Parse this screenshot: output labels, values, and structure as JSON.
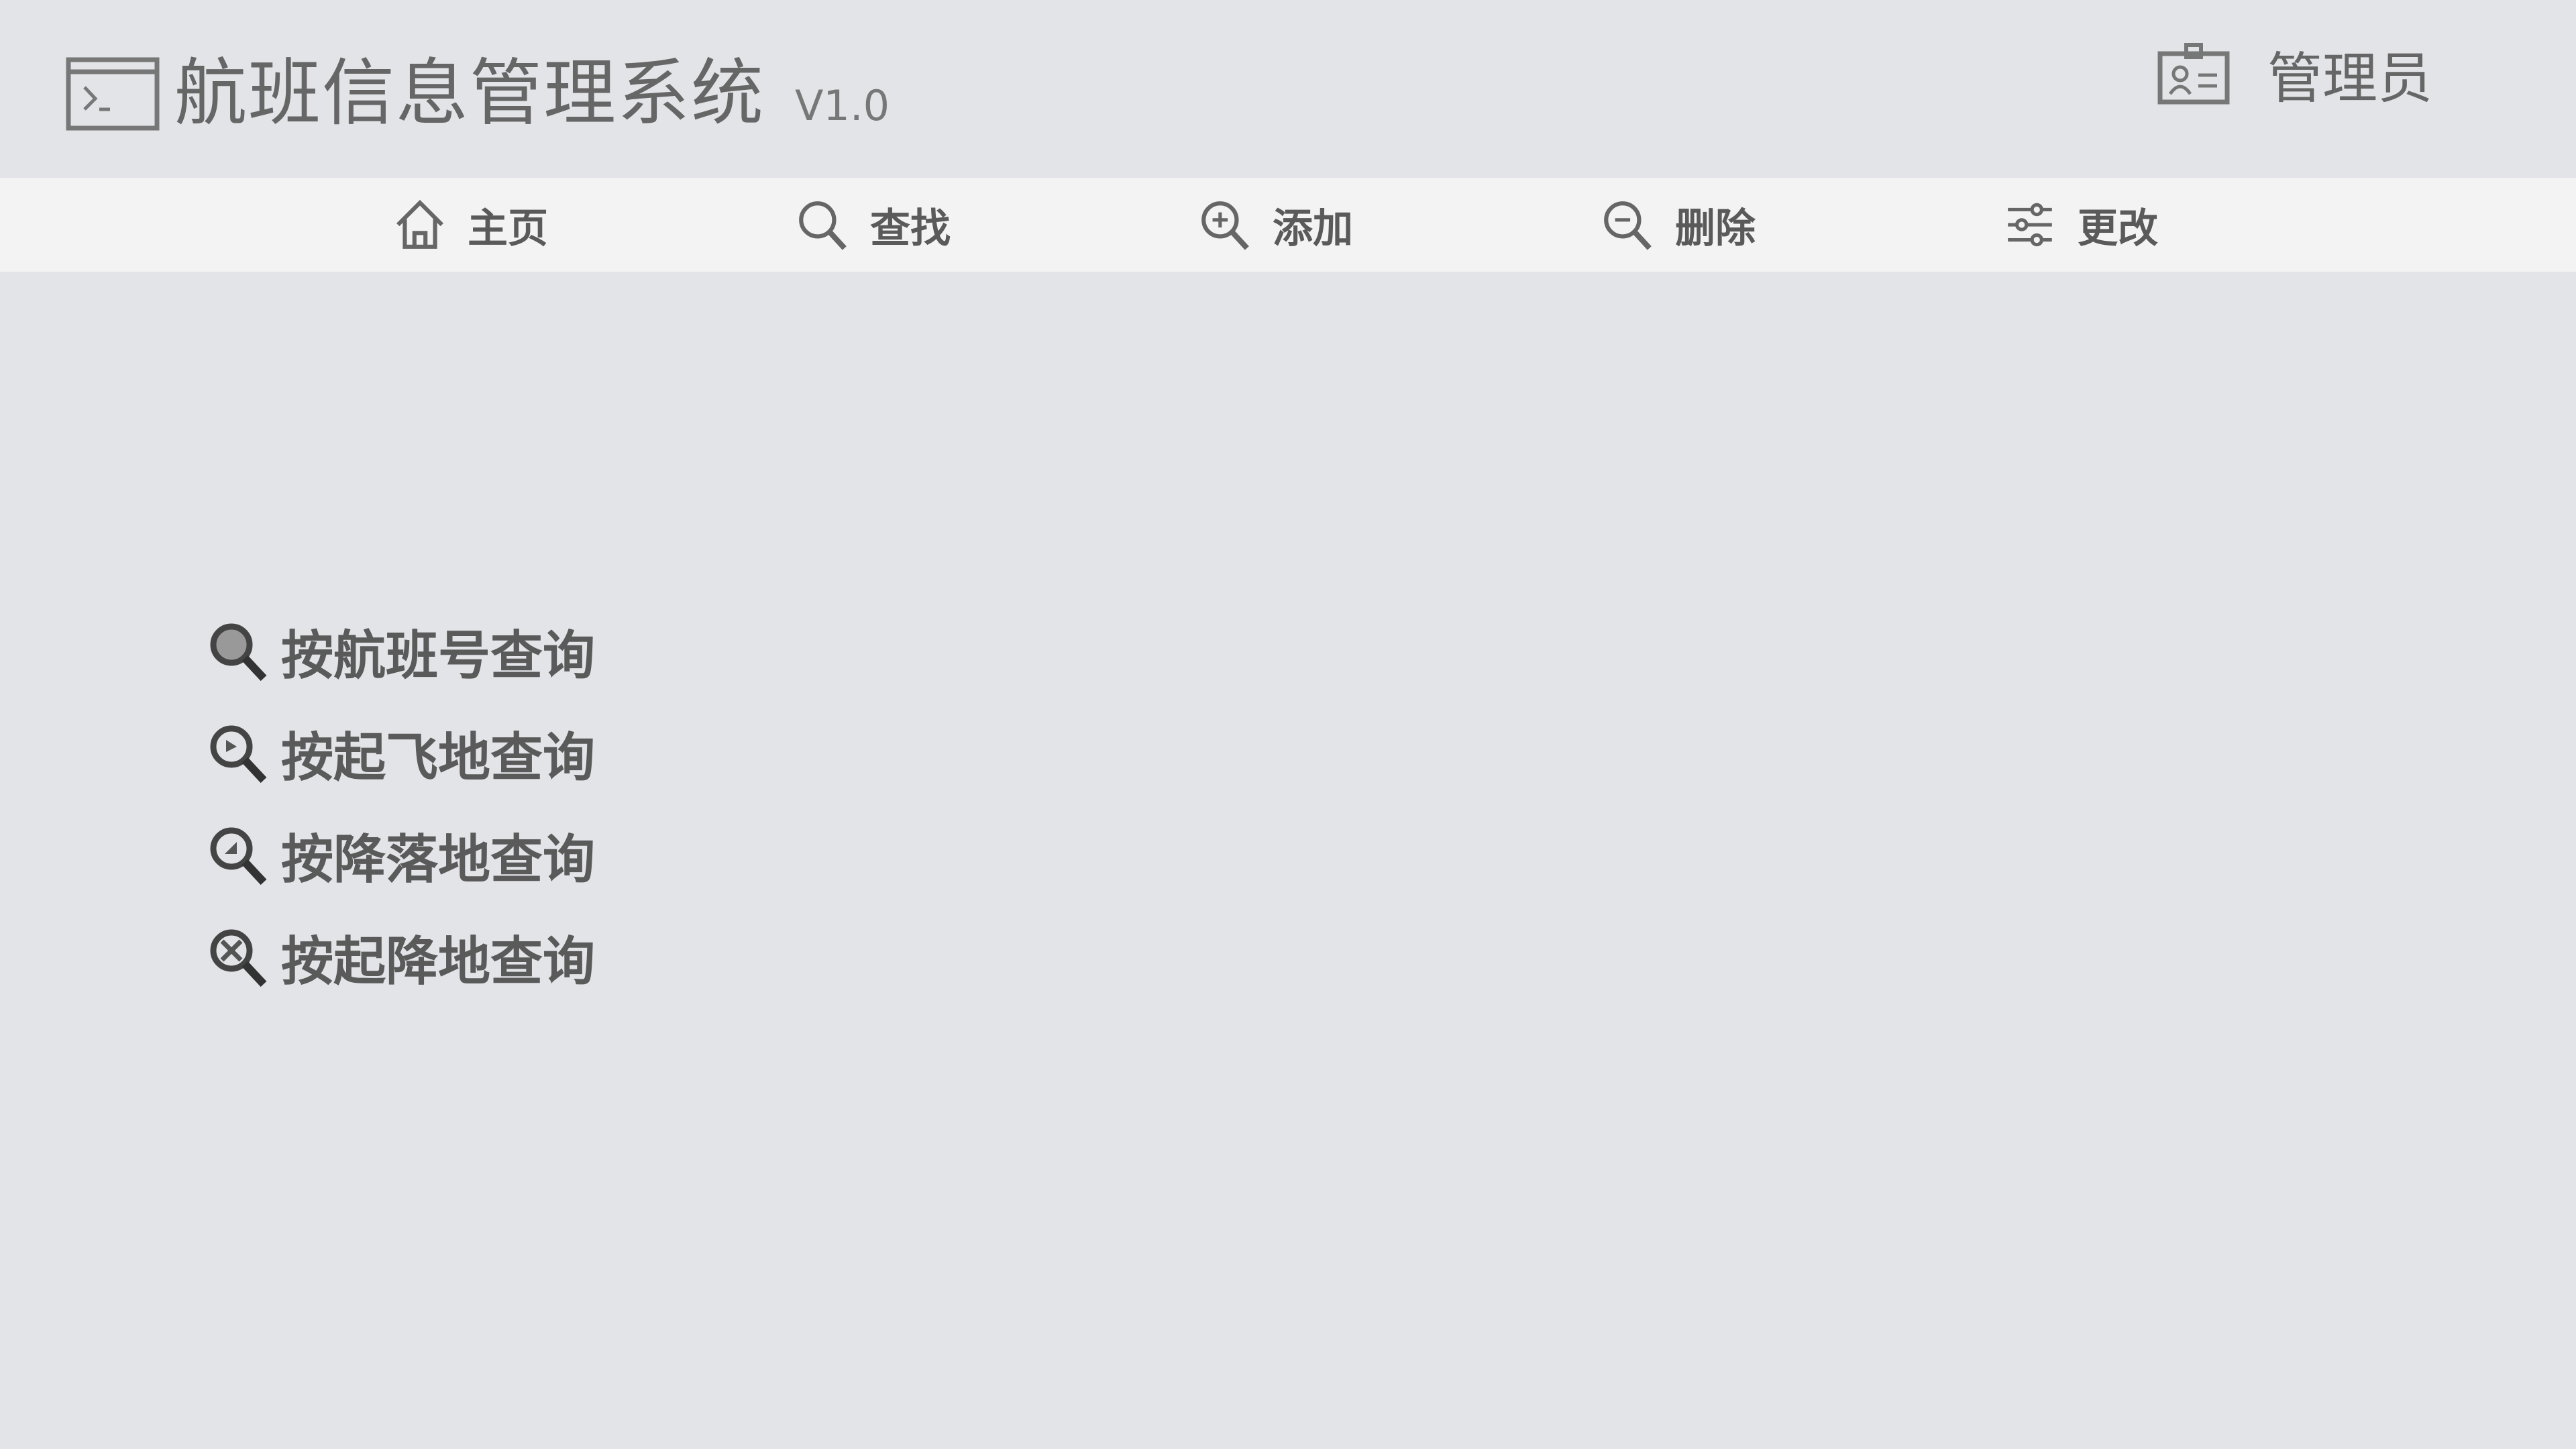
{
  "header": {
    "title": "航班信息管理系统",
    "version": "V1.0",
    "user_label": "管理员"
  },
  "nav": {
    "items": [
      {
        "label": "主页",
        "icon": "home-icon"
      },
      {
        "label": "查找",
        "icon": "search-icon"
      },
      {
        "label": "添加",
        "icon": "zoom-in-icon"
      },
      {
        "label": "删除",
        "icon": "zoom-out-icon"
      },
      {
        "label": "更改",
        "icon": "sliders-icon"
      }
    ]
  },
  "query_links": [
    {
      "label": "按航班号查询"
    },
    {
      "label": "按起飞地查询"
    },
    {
      "label": "按降落地查询"
    },
    {
      "label": "按起降地查询"
    }
  ],
  "colors": {
    "header_bg": "#e3e4e8",
    "nav_bg": "#f3f3f3",
    "text": "#555555"
  }
}
